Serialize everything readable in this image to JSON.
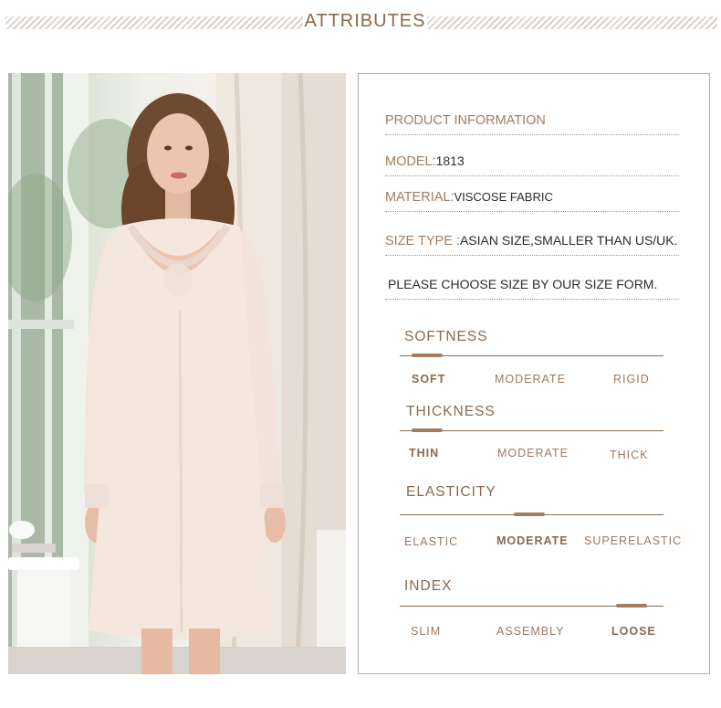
{
  "header": {
    "title": "ATTRIBUTES"
  },
  "product": {
    "heading": "PRODUCT INFORMATION",
    "model_label": "MODEL:",
    "model_value": "1813",
    "material_label": "MATERIAL:",
    "material_value": "VISCOSE FABRIC",
    "size_type_label": "SIZE TYPE :",
    "size_type_value": "ASIAN SIZE,SMALLER THAN US/UK.",
    "note": "PLEASE CHOOSE SIZE BY OUR SIZE FORM."
  },
  "attributes": {
    "softness": {
      "title": "SOFTNESS",
      "options": [
        "SOFT",
        "MODERATE",
        "RIGID"
      ],
      "selected": "SOFT"
    },
    "thickness": {
      "title": "THICKNESS",
      "options": [
        "THIN",
        "MODERATE",
        "THICK"
      ],
      "selected": "THIN"
    },
    "elasticity": {
      "title": "ELASTICITY",
      "options": [
        "ELASTIC",
        "MODERATE",
        "SUPERELASTIC"
      ],
      "selected": "MODERATE"
    },
    "index": {
      "title": "INDEX",
      "options": [
        "SLIM",
        "ASSEMBLY",
        "LOOSE"
      ],
      "selected": "LOOSE"
    }
  },
  "colors": {
    "accent": "#8a6a4f",
    "marker": "#a47c5e",
    "value_text": "#2b2b2b"
  }
}
